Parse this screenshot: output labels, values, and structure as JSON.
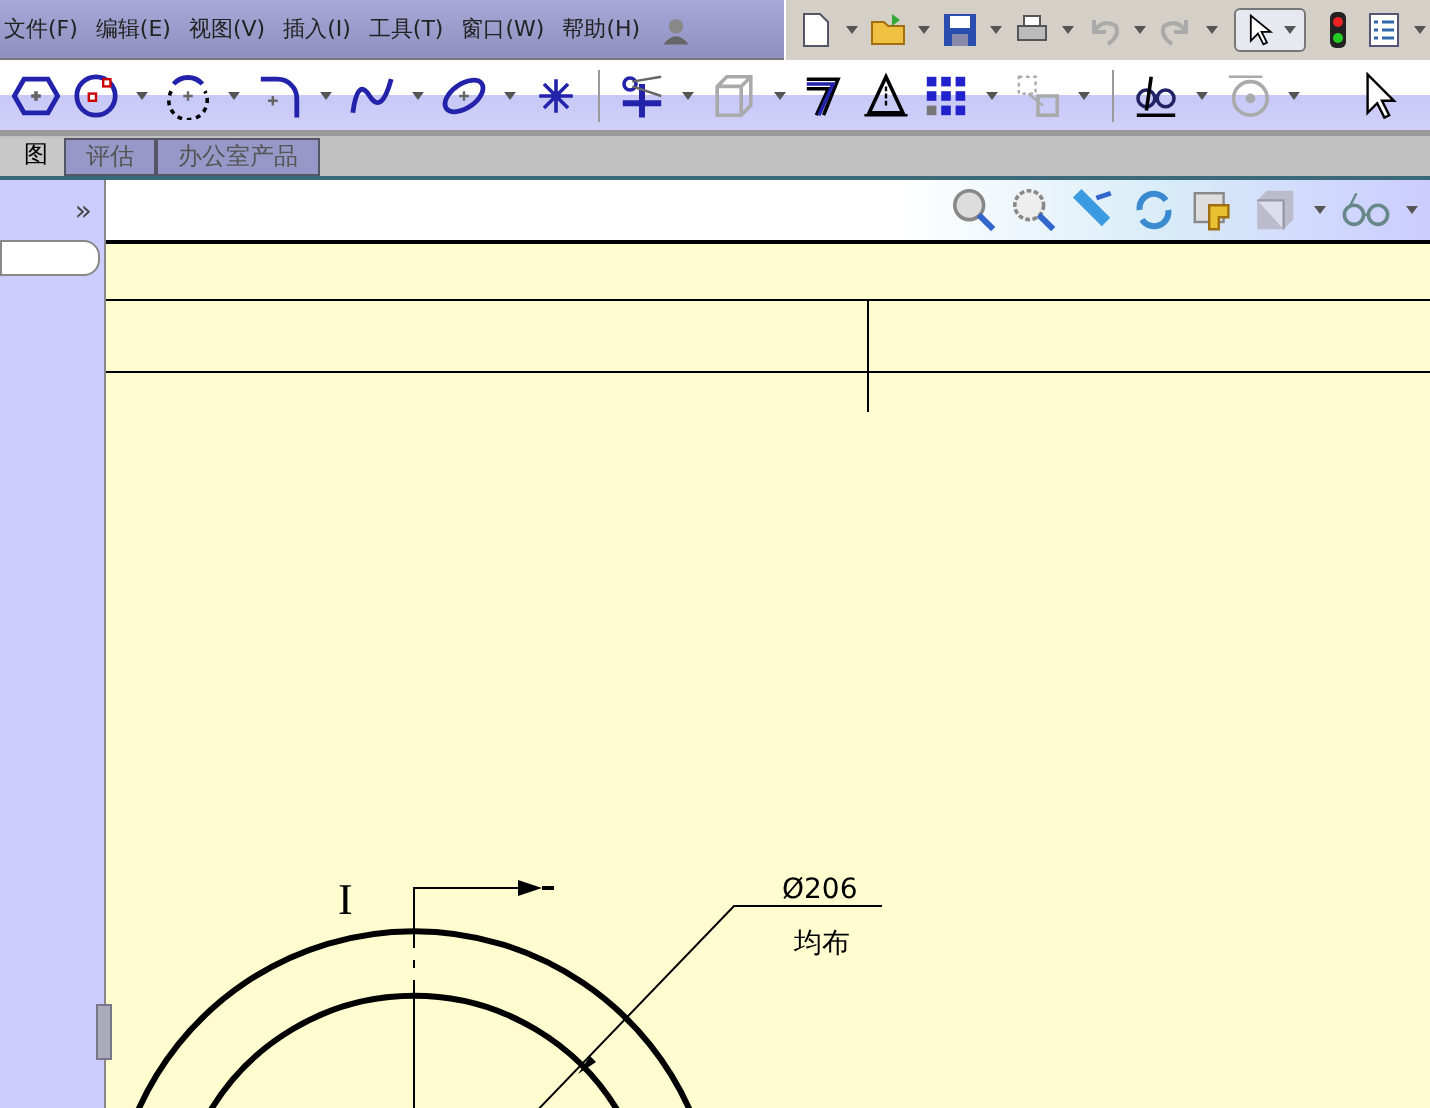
{
  "menu": [
    {
      "label": "文件(F)"
    },
    {
      "label": "编辑(E)"
    },
    {
      "label": "视图(V)"
    },
    {
      "label": "插入(I)"
    },
    {
      "label": "工具(T)"
    },
    {
      "label": "窗口(W)"
    },
    {
      "label": "帮助(H)"
    }
  ],
  "tabs": [
    {
      "label": "图",
      "selected": true
    },
    {
      "label": "评估",
      "selected": false
    },
    {
      "label": "办公室产品",
      "selected": false
    }
  ],
  "panel": {
    "expand": "»"
  },
  "drawing": {
    "section_mark": "I",
    "diameter": "Ø206",
    "note": "均布"
  }
}
